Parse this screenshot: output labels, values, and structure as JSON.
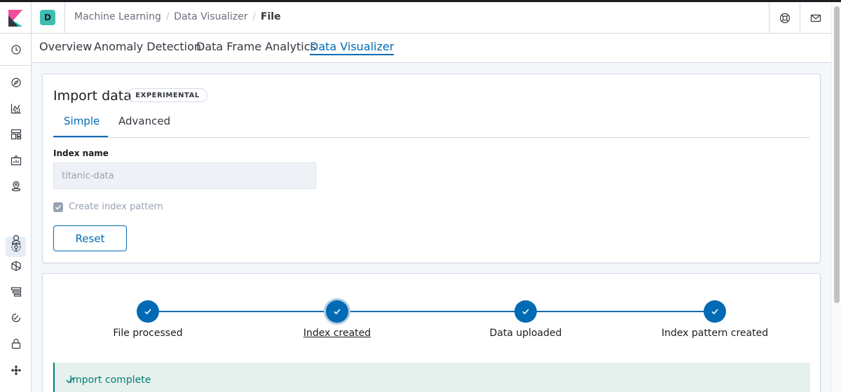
{
  "breadcrumbs": [
    "Machine Learning",
    "Data Visualizer",
    "File"
  ],
  "space": {
    "initial": "D"
  },
  "header_icons": [
    "help-icon",
    "mail-icon"
  ],
  "sidenav_icons": [
    "recent-icon",
    "discover-icon",
    "visualize-icon",
    "dashboard-icon",
    "canvas-icon",
    "maps-icon",
    "machine-learning-icon",
    "uptime-icon",
    "apm-icon",
    "logs-icon",
    "monitoring-icon",
    "security-icon",
    "graph-icon"
  ],
  "ml_tabs": [
    "Overview",
    "Anomaly Detection",
    "Data Frame Analytics",
    "Data Visualizer"
  ],
  "active_ml_tab": "Data Visualizer",
  "import": {
    "title": "Import data",
    "badge": "EXPERIMENTAL",
    "tabs": [
      "Simple",
      "Advanced"
    ],
    "active_tab": "Simple",
    "index_name_label": "Index name",
    "index_name_value": "titanic-data",
    "create_index_pattern_label": "Create index pattern",
    "create_index_pattern_checked": true,
    "reset_label": "Reset"
  },
  "steps": [
    {
      "label": "File processed",
      "complete": true
    },
    {
      "label": "Index created",
      "complete": true
    },
    {
      "label": "Data uploaded",
      "complete": true
    },
    {
      "label": "Index pattern created",
      "complete": true
    }
  ],
  "status": {
    "text": "Import complete"
  },
  "colors": {
    "primary": "#006bb4",
    "success": "#017d73",
    "space_avatar": "#3ebeb0"
  }
}
